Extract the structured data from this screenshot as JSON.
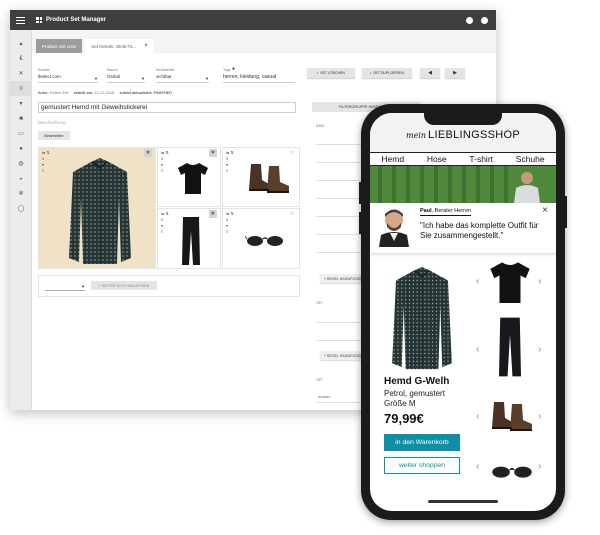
{
  "app": {
    "title": "Product Set Manager",
    "tabs": [
      {
        "label": "Product Set Liste"
      },
      {
        "label": "Set Details: 39c8c7a..."
      }
    ],
    "sidebar_icons": [
      "chart-icon",
      "euro-icon",
      "shuffle-icon",
      "list-icon",
      "shirt-icon",
      "bag-icon",
      "monitor-icon",
      "users-icon",
      "user-settings-icon",
      "basket-icon",
      "gear-icon",
      "power-icon"
    ],
    "fields": {
      "kunden_label": "Kunden",
      "kunden_value": "lbelect.com",
      "saison_label": "Saison",
      "saison_value": "Global",
      "sicht_label": "Sichtbarkeit",
      "sicht_value": "sichtbar",
      "tags_label": "Tags",
      "tags_value": "herren, kleidung, casual"
    },
    "buttons": {
      "delete": "SET LÖSCHEN",
      "duplicate": "SET DUPLIZIEREN"
    },
    "meta": {
      "autor_label": "Autor:",
      "autor_value": "Ketten Ent",
      "created_label": "erstellt am:",
      "created_value": "12.12.2018",
      "status_label": "zuletzt aktualisiert:",
      "status_value": "FINISHED"
    },
    "set_title": "gemustert Hemd mit Geweihstickerei",
    "description_label": "Beschreibung",
    "edit_button": "Bearbeiten",
    "add_slot_button": "+ WEITER SLOT HINZUFÜGEN",
    "filter_button": "FILTERGRUPPE HINZUFÜGEN",
    "rules": {
      "and_label": "AND",
      "or_label": "OR",
      "add_rule": "+ REGEL HINZUFÜGEN",
      "rule_values": [
        "muster",
        "muster"
      ]
    }
  },
  "shop": {
    "logo_script": "mein",
    "logo_main": "LIEBLINGSSHOP",
    "nav": [
      "Hemd",
      "Hose",
      "T-shirt",
      "Schuhe"
    ],
    "advisor_name": "Paul",
    "advisor_role": ", Berater Herren",
    "quote": "\"Ich habe das komplette Outfit für Sie zusammengestellt.\"",
    "product_name": "Hemd G-Welh",
    "product_desc": "Petrol, gemustert",
    "product_size": "Größe M",
    "price": "79,99€",
    "cart_button": "in den Warenkorb",
    "continue_button": "weiter shoppen"
  },
  "colors": {
    "accent": "#0e8fa6",
    "topbar": "#3f3f3f",
    "shirt": "#22343c"
  }
}
